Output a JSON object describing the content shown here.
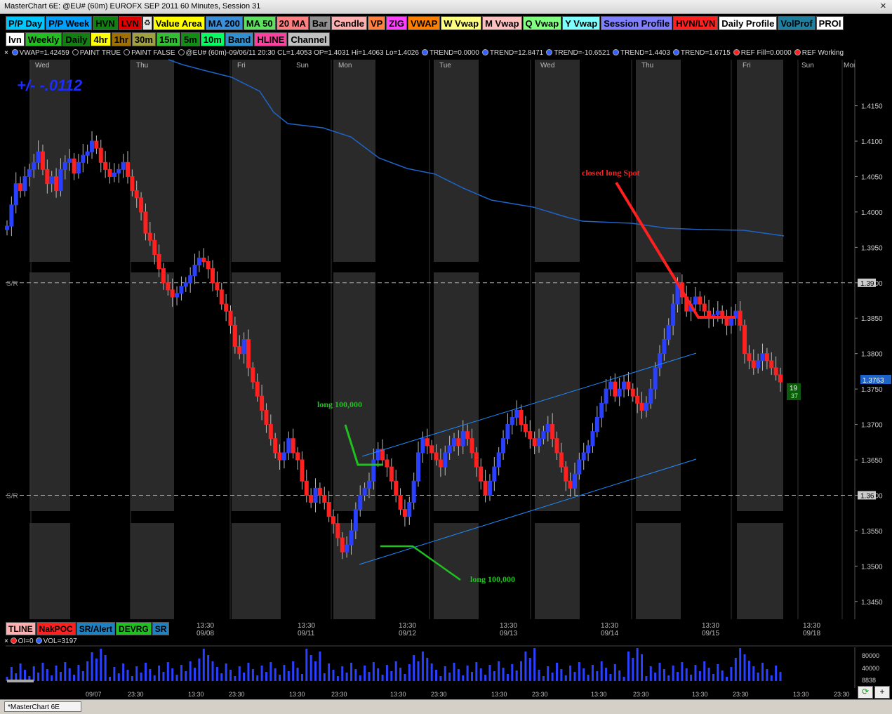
{
  "window": {
    "title": "MasterChart 6E: @EU# (60m) EUROFX SEP 2011 60 Minutes, Session 31"
  },
  "toolbar_row1": [
    {
      "label": "P/P Day",
      "bg": "#00c8ff",
      "fg": "#000"
    },
    {
      "label": "P/P Week",
      "bg": "#00a0ff",
      "fg": "#000"
    },
    {
      "label": "HVN",
      "bg": "#108010",
      "fg": "#000"
    },
    {
      "label": "LVN",
      "bg": "#e00000",
      "fg": "#000"
    },
    {
      "label": "",
      "bg": "#e8e8e8",
      "fg": "#000",
      "icon": "recycle-icon"
    },
    {
      "label": "Value Area",
      "bg": "#ffff00",
      "fg": "#000"
    },
    {
      "label": "MA 200",
      "bg": "#3a8fd8",
      "fg": "#000"
    },
    {
      "label": "MA 50",
      "bg": "#60e060",
      "fg": "#000"
    },
    {
      "label": "20 MA",
      "bg": "#ff8080",
      "fg": "#000"
    },
    {
      "label": "Bar",
      "bg": "#909090",
      "fg": "#000"
    },
    {
      "label": "Candle",
      "bg": "#ffb0b0",
      "fg": "#000"
    },
    {
      "label": "VP",
      "bg": "#ff8040",
      "fg": "#000"
    },
    {
      "label": "ZIG",
      "bg": "#ff40ff",
      "fg": "#000"
    },
    {
      "label": "VWAP",
      "bg": "#ff8000",
      "fg": "#000"
    },
    {
      "label": "W Vwap",
      "bg": "#ffff80",
      "fg": "#000"
    },
    {
      "label": "M Vwap",
      "bg": "#ffc0c0",
      "fg": "#000"
    },
    {
      "label": "Q Vwap",
      "bg": "#80ff80",
      "fg": "#000"
    },
    {
      "label": "Y Vwap",
      "bg": "#80ffff",
      "fg": "#000"
    },
    {
      "label": "Session Profile",
      "bg": "#8080ff",
      "fg": "#000"
    },
    {
      "label": "HVN/LVN",
      "bg": "#ff2020",
      "fg": "#000"
    },
    {
      "label": "Daily Profile",
      "bg": "#ffffff",
      "fg": "#000"
    },
    {
      "label": "VolProf",
      "bg": "#2080a0",
      "fg": "#000"
    },
    {
      "label": "PROI",
      "bg": "#ffffff",
      "fg": "#000"
    }
  ],
  "toolbar_row2": [
    {
      "label": "lvn",
      "bg": "#ffffff",
      "fg": "#000"
    },
    {
      "label": "Weekly",
      "bg": "#20c020",
      "fg": "#000"
    },
    {
      "label": "Daily",
      "bg": "#108010",
      "fg": "#000"
    },
    {
      "label": "4hr",
      "bg": "#ffff00",
      "fg": "#000"
    },
    {
      "label": "1hr",
      "bg": "#a07000",
      "fg": "#000"
    },
    {
      "label": "30m",
      "bg": "#a0a040",
      "fg": "#000"
    },
    {
      "label": "15m",
      "bg": "#30c030",
      "fg": "#000"
    },
    {
      "label": "5m",
      "bg": "#109010",
      "fg": "#000"
    },
    {
      "label": "10m",
      "bg": "#00ff60",
      "fg": "#000"
    },
    {
      "label": "Band",
      "bg": "#3090d0",
      "fg": "#000"
    },
    {
      "label": "HLINE",
      "bg": "#ff40a0",
      "fg": "#000"
    },
    {
      "label": "Channel",
      "bg": "#c0c0c0",
      "fg": "#000"
    }
  ],
  "info_bar": {
    "close_label": "×",
    "items": [
      {
        "text": "VWAP=1.42459",
        "dot": "#3060ff"
      },
      {
        "text": "PAINT TRUE",
        "dot": "#000000"
      },
      {
        "text": "PAINT FALSE",
        "dot": "#000000"
      },
      {
        "text": "@EU# (60m)-09/06/11 20:30 CL=1.4053 OP=1.4031 Hi=1.4063 Lo=1.4026",
        "dot": "#000000"
      },
      {
        "text": "TREND=0.0000",
        "dot": "#3060ff"
      },
      {
        "text": "TREND=12.8471",
        "dot": "#3060ff"
      },
      {
        "text": "TREND=-10.6521",
        "dot": "#3060ff"
      },
      {
        "text": "TREND=1.4403",
        "dot": "#3060ff"
      },
      {
        "text": "TREND=1.6715",
        "dot": "#3060ff"
      },
      {
        "text": "REF Fill=0.0000",
        "dot": "#ff2020"
      },
      {
        "text": "REF Working",
        "dot": "#ff2020"
      }
    ]
  },
  "chart_data": {
    "type": "candlestick",
    "symbol": "@EU# (60m)",
    "days": [
      "Wed",
      "Thu",
      "Fri",
      "Sun",
      "Mon",
      "Tue",
      "Wed",
      "Thu",
      "Fri",
      "Sun",
      "Mon"
    ],
    "time_labels": [
      {
        "t": "13:30",
        "d": "09/08"
      },
      {
        "t": "13:30",
        "d": "09/11"
      },
      {
        "t": "13:30",
        "d": "09/12"
      },
      {
        "t": "13:30",
        "d": "09/13"
      },
      {
        "t": "13:30",
        "d": "09/14"
      },
      {
        "t": "13:30",
        "d": "09/15"
      },
      {
        "t": "13:30",
        "d": "09/18"
      }
    ],
    "y_ticks": [
      "1.4150",
      "1.4100",
      "1.4050",
      "1.4000",
      "1.3950",
      "1.3900",
      "1.3850",
      "1.3800",
      "1.3750",
      "1.3700",
      "1.3650",
      "1.3600",
      "1.3550",
      "1.3500",
      "1.3450"
    ],
    "y_range": [
      1.3425,
      1.4215
    ],
    "sr_levels": [
      {
        "label": "S/R",
        "value": 1.39,
        "tag": "1.39"
      },
      {
        "label": "S/R",
        "value": 1.36,
        "tag": "1.36"
      }
    ],
    "current_price": "1.3763",
    "countdown": {
      "top": "19",
      "bottom": "37"
    },
    "pl_label": "+/-   -.0112",
    "closes": [
      1.398,
      1.401,
      1.404,
      1.403,
      1.405,
      1.406,
      1.407,
      1.4085,
      1.406,
      1.404,
      1.405,
      1.403,
      1.406,
      1.407,
      1.4075,
      1.4055,
      1.407,
      1.408,
      1.4085,
      1.41,
      1.409,
      1.407,
      1.406,
      1.405,
      1.4055,
      1.406,
      1.407,
      1.405,
      1.403,
      1.402,
      1.4,
      1.397,
      1.396,
      1.394,
      1.392,
      1.39,
      1.389,
      1.388,
      1.3885,
      1.3895,
      1.39,
      1.391,
      1.3925,
      1.3935,
      1.393,
      1.392,
      1.39,
      1.389,
      1.387,
      1.386,
      1.384,
      1.381,
      1.38,
      1.382,
      1.378,
      1.376,
      1.374,
      1.372,
      1.37,
      1.368,
      1.366,
      1.365,
      1.366,
      1.368,
      1.366,
      1.365,
      1.362,
      1.36,
      1.359,
      1.361,
      1.36,
      1.359,
      1.357,
      1.356,
      1.354,
      1.352,
      1.353,
      1.355,
      1.358,
      1.36,
      1.361,
      1.362,
      1.365,
      1.3665,
      1.365,
      1.364,
      1.362,
      1.36,
      1.358,
      1.357,
      1.359,
      1.362,
      1.366,
      1.368,
      1.367,
      1.366,
      1.365,
      1.364,
      1.366,
      1.367,
      1.368,
      1.367,
      1.369,
      1.368,
      1.366,
      1.364,
      1.362,
      1.36,
      1.362,
      1.364,
      1.366,
      1.368,
      1.37,
      1.371,
      1.372,
      1.37,
      1.369,
      1.368,
      1.367,
      1.368,
      1.369,
      1.37,
      1.368,
      1.366,
      1.364,
      1.362,
      1.361,
      1.363,
      1.365,
      1.366,
      1.367,
      1.369,
      1.371,
      1.373,
      1.375,
      1.376,
      1.374,
      1.375,
      1.376,
      1.375,
      1.374,
      1.373,
      1.372,
      1.373,
      1.375,
      1.378,
      1.38,
      1.382,
      1.384,
      1.387,
      1.39,
      1.388,
      1.386,
      1.387,
      1.388,
      1.387,
      1.386,
      1.385,
      1.3855,
      1.386,
      1.385,
      1.384,
      1.385,
      1.386,
      1.384,
      1.38,
      1.379,
      1.378,
      1.379,
      1.38,
      1.379,
      1.378,
      1.377,
      1.376
    ],
    "vwap_label": "VWAP=1.42459",
    "annotations": [
      {
        "text": "closed long Spot",
        "color": "#ff2020"
      },
      {
        "text": "long 100,000",
        "color": "#20c020"
      },
      {
        "text": "long 100,000",
        "color": "#20c020"
      }
    ]
  },
  "bottom_buttons": [
    {
      "label": "TLINE",
      "bg": "#ffb0b0",
      "fg": "#000"
    },
    {
      "label": "NakPOC",
      "bg": "#ff2020",
      "fg": "#000"
    },
    {
      "label": "SR/Alert",
      "bg": "#2080c0",
      "fg": "#000"
    },
    {
      "label": "DEVRG",
      "bg": "#20c020",
      "fg": "#000"
    },
    {
      "label": "SR",
      "bg": "#2080c0",
      "fg": "#000"
    }
  ],
  "volume_pane": {
    "info": [
      {
        "text": "OI=0",
        "dot": "#ff2020"
      },
      {
        "text": "VOL=3197",
        "dot": "#3060ff"
      }
    ],
    "y_ticks": [
      "80000",
      "40000",
      "8838"
    ],
    "x_labels": [
      "09/07",
      "23:30",
      "13:30",
      "23:30",
      "13:30",
      "23:30",
      "13:30",
      "23:30",
      "13:30",
      "23:30",
      "13:30",
      "23:30",
      "13:30",
      "23:30",
      "13:30",
      "23:30",
      "13:30",
      "23:30"
    ]
  },
  "status_bar": {
    "tab_label": "*MasterChart 6E"
  }
}
